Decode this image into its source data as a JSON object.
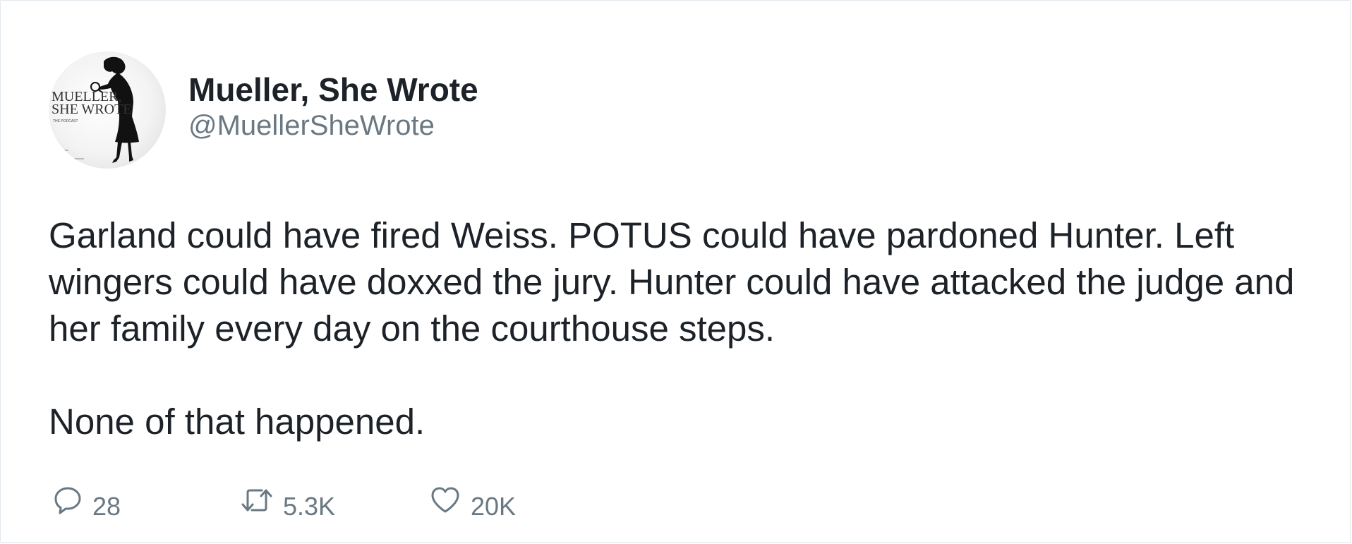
{
  "tweet": {
    "author": {
      "display_name": "Mueller, She Wrote",
      "handle": "@MuellerSheWrote",
      "avatar": {
        "line1": "MUELLER,",
        "line2": "SHE WROTE",
        "line3": "THE PODCAST"
      }
    },
    "text_lines": [
      "Garland could have fired Weiss. POTUS could have pardoned Hunter. Left wingers could have doxxed the jury. Hunter could have attacked the judge and her family every day on the courthouse steps.",
      "None of that happened."
    ],
    "actions": {
      "reply": {
        "icon": "reply-icon",
        "count": "28"
      },
      "retweet": {
        "icon": "retweet-icon",
        "count": "5.3K"
      },
      "like": {
        "icon": "heart-icon",
        "count": "20K"
      }
    }
  },
  "colors": {
    "text": "#1c2228",
    "secondary": "#697882",
    "border": "#e1e8ed",
    "background": "#ffffff"
  }
}
